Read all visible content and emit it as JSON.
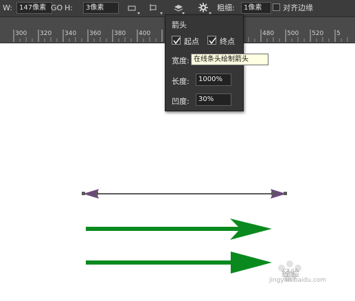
{
  "options_bar": {
    "w_label": "W:",
    "w_value": "147像素",
    "go_label": "GO",
    "h_label": "H:",
    "h_value": "3像素",
    "thickness_label": "粗细:",
    "thickness_value": "1像素",
    "align_edges_label": "对齐边缘"
  },
  "ruler": {
    "ticks": [
      "300",
      "320",
      "340",
      "360",
      "380",
      "400",
      "480",
      "500",
      "520",
      "5"
    ]
  },
  "arrow_panel": {
    "title": "箭头",
    "start_label": "起点",
    "end_label": "终点",
    "width_label": "宽度:",
    "length_label": "长度:",
    "length_value": "1000%",
    "concavity_label": "凹度:",
    "concavity_value": "30%",
    "start_checked": true,
    "end_checked": true
  },
  "tooltip": {
    "text": "在线条头绘制箭头"
  },
  "watermark": {
    "text": "经验",
    "url": "jingyan.baidu.com"
  },
  "colors": {
    "arrow_green": "#0a8a1e",
    "line_gray": "#5a5a5a",
    "handle_purple": "#7a4a8a"
  }
}
